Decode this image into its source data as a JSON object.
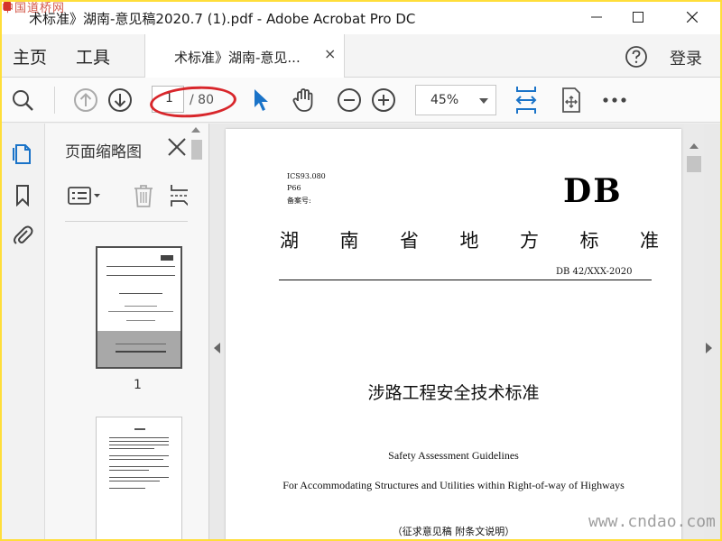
{
  "window": {
    "title": "术标准》湖南-意见稿2020.7 (1).pdf - Adobe Acrobat Pro DC",
    "watermark_top": "中国道桥网",
    "watermark_bottom": "www.cndao.com"
  },
  "menu": {
    "home": "主页",
    "tools": "工具",
    "doc_tab": "术标准》湖南-意见...",
    "close": "×",
    "login": "登录"
  },
  "toolbar": {
    "page_current": "1",
    "page_total": "/ 80",
    "zoom": "45%"
  },
  "thumb_panel": {
    "title": "页面缩略图",
    "thumb1_number": "1"
  },
  "page": {
    "ics": "ICS93.080",
    "p66": "P66",
    "filing": "备案号:",
    "db": "DB",
    "province_chars": [
      "湖",
      "南",
      "省",
      "地",
      "方",
      "标",
      "准"
    ],
    "code": "DB 42/XXX-2020",
    "title_cn": "涉路工程安全技术标准",
    "title_en1": "Safety Assessment Guidelines",
    "title_en2": "For Accommodating Structures and Utilities within Right-of-way of Highways",
    "note": "（征求意见稿  附条文说明）"
  },
  "colors": {
    "accent": "#1a73c8",
    "highlight": "#d8262b",
    "border": "#ffde3a"
  }
}
